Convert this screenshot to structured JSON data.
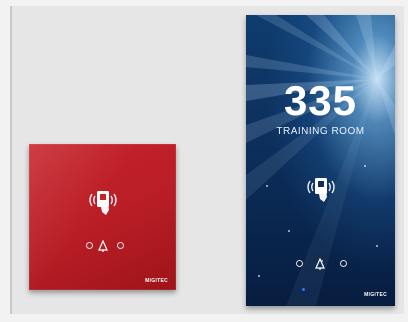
{
  "images": {
    "red_panel": {
      "brand": "MIGITEC",
      "icons": [
        "nfc-card-icon",
        "status-dot-icon",
        "bell-icon",
        "status-dot-icon"
      ]
    },
    "blue_panel": {
      "room_number": "335",
      "room_name": "TRAINING ROOM",
      "brand": "MIGITEC",
      "icons": [
        "nfc-card-icon",
        "status-dot-icon",
        "bell-icon",
        "status-dot-icon"
      ]
    }
  },
  "colors": {
    "red_panel": "#b81d25",
    "blue_panel": "#0c2f5c",
    "background": "#e6e6e6"
  }
}
